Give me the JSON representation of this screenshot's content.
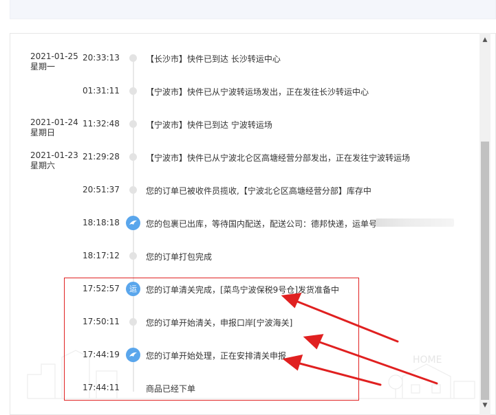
{
  "colors": {
    "accent_blue": "#5aa6ec",
    "annotation_red": "#e02020",
    "dot_gray": "#e3e3e3"
  },
  "events": [
    {
      "date": "2021-01-25",
      "weekday": "星期一",
      "time": "20:33:13",
      "icon": "dot",
      "text": "【长沙市】快件已到达 长沙转运中心"
    },
    {
      "date": "",
      "weekday": "",
      "time": "01:31:11",
      "icon": "dot",
      "text": "【宁波市】快件已从宁波转运场发出，正在发往长沙转运中心"
    },
    {
      "date": "2021-01-24",
      "weekday": "星期日",
      "time": "11:32:48",
      "icon": "dot",
      "text": "【宁波市】快件已到达 宁波转运场"
    },
    {
      "date": "2021-01-23",
      "weekday": "星期六",
      "time": "21:29:28",
      "icon": "dot",
      "text": "【宁波市】快件已从宁波北仑区高塘经营分部发出，正在发往宁波转运场"
    },
    {
      "date": "",
      "weekday": "",
      "time": "20:51:37",
      "icon": "dot",
      "text": "您的订单已被收件员揽收,【宁波北仑区高塘经营分部】库存中"
    },
    {
      "date": "",
      "weekday": "",
      "time": "18:18:18",
      "icon": "bird-icon",
      "text": "您的包裹已出库，等待国内配送，配送公司：德邦快递，运单号"
    },
    {
      "date": "",
      "weekday": "",
      "time": "18:17:12",
      "icon": "dot",
      "text": "您的订单打包完成"
    },
    {
      "date": "",
      "weekday": "",
      "time": "17:52:57",
      "icon": "transport-badge",
      "badge_text": "运",
      "text": "您的订单清关完成，[菜鸟宁波保税9号仓]发货准备中"
    },
    {
      "date": "",
      "weekday": "",
      "time": "17:50:11",
      "icon": "dot",
      "text": "您的订单开始清关，申报口岸[宁波海关]"
    },
    {
      "date": "",
      "weekday": "",
      "time": "17:44:19",
      "icon": "bird-icon",
      "text": "您的订单开始处理，正在安排清关申报"
    },
    {
      "date": "",
      "weekday": "",
      "time": "17:44:11",
      "icon": "dot",
      "text": "商品已经下单"
    }
  ],
  "watermark": {
    "text": "HOME"
  }
}
